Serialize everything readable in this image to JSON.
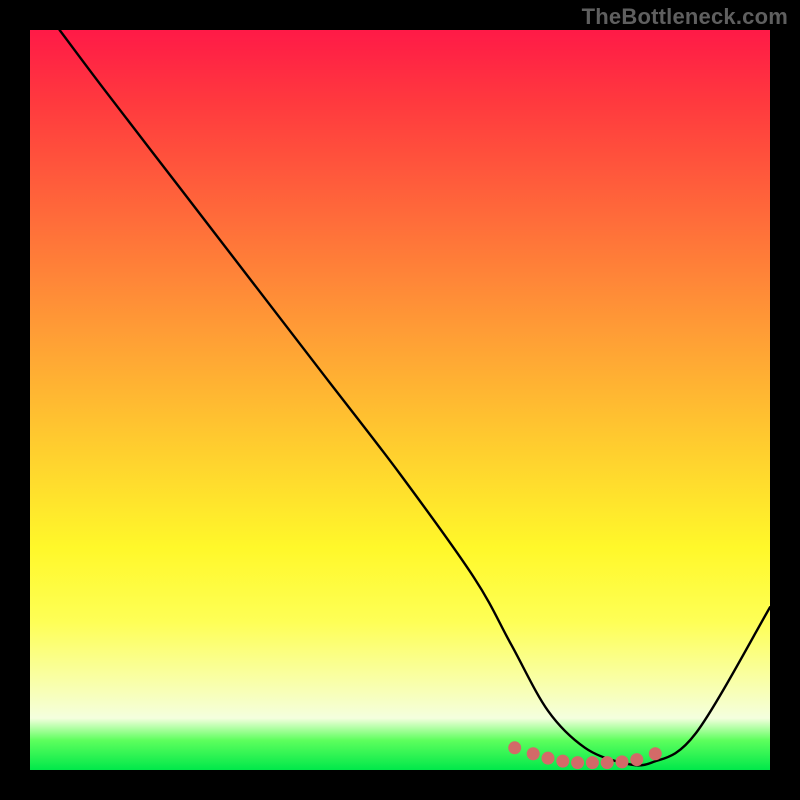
{
  "watermark": "TheBottleneck.com",
  "chart_data": {
    "type": "line",
    "title": "",
    "xlabel": "",
    "ylabel": "",
    "xlim": [
      0,
      100
    ],
    "ylim": [
      0,
      100
    ],
    "series": [
      {
        "name": "bottleneck-curve",
        "x": [
          4,
          10,
          20,
          30,
          40,
          50,
          60,
          65,
          70,
          75,
          80,
          84,
          90,
          100
        ],
        "values": [
          100,
          92,
          79,
          66,
          53,
          40,
          26,
          17,
          8,
          3,
          1,
          1,
          5,
          22
        ]
      }
    ],
    "markers": {
      "name": "optimal-zone",
      "color": "#d36a68",
      "x": [
        65.5,
        68,
        70,
        72,
        74,
        76,
        78,
        80,
        82,
        84.5
      ],
      "values": [
        3.0,
        2.2,
        1.6,
        1.2,
        1.0,
        1.0,
        1.0,
        1.1,
        1.4,
        2.2
      ]
    },
    "gradient_stops": [
      {
        "pos": 0,
        "color": "#ff1a47"
      },
      {
        "pos": 10,
        "color": "#ff3a3e"
      },
      {
        "pos": 25,
        "color": "#ff6a3a"
      },
      {
        "pos": 40,
        "color": "#ff9a36"
      },
      {
        "pos": 55,
        "color": "#ffc92f"
      },
      {
        "pos": 70,
        "color": "#fff82a"
      },
      {
        "pos": 80,
        "color": "#feff56"
      },
      {
        "pos": 88,
        "color": "#f9ffa8"
      },
      {
        "pos": 93,
        "color": "#f4ffde"
      },
      {
        "pos": 96,
        "color": "#5dff5d"
      },
      {
        "pos": 100,
        "color": "#00e84a"
      }
    ]
  }
}
